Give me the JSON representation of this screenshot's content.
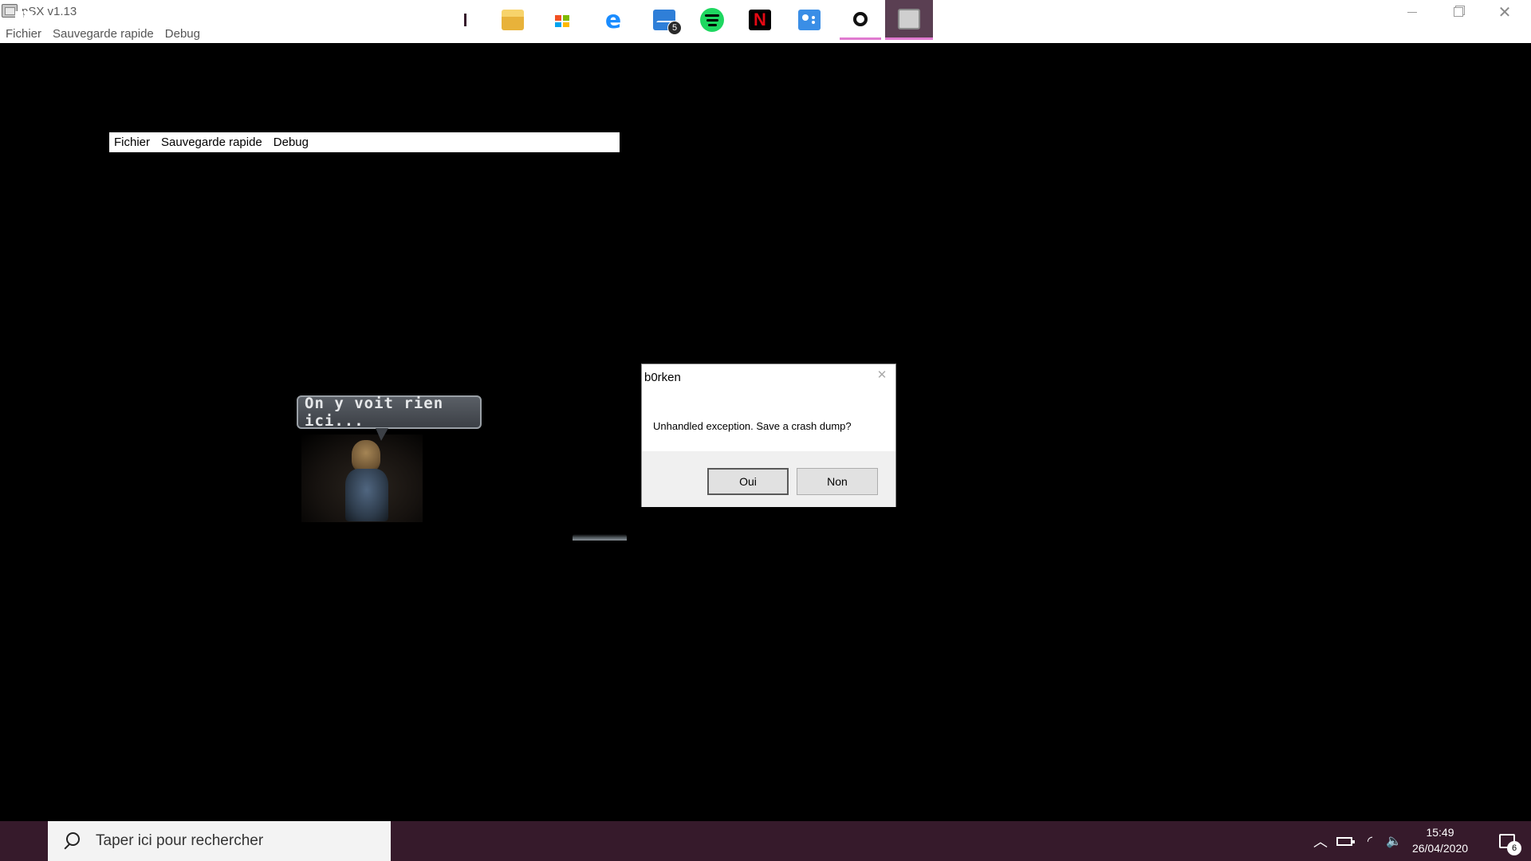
{
  "window": {
    "title": "pSX v1.13",
    "close_glyph": "✕"
  },
  "menubar": {
    "items": [
      "Fichier",
      "Sauvegarde rapide",
      "Debug"
    ]
  },
  "emulator": {
    "ghost_menu_items": [
      "Fichier",
      "Sauvegarde rapide",
      "Debug"
    ],
    "speech_bubble": "On y voit rien ici..."
  },
  "dialog": {
    "title": "b0rken",
    "message": "Unhandled exception.  Save a crash dump?",
    "yes_label": "Oui",
    "no_label": "Non",
    "close_glyph": "✕"
  },
  "taskbar": {
    "search_placeholder": "Taper ici pour rechercher",
    "mail_badge": "5",
    "netflix_glyph": "N",
    "edge_glyph": "e",
    "tray_chevron": "︿",
    "wifi_glyph": "◜",
    "volume_glyph": "🔈",
    "time": "15:49",
    "date": "26/04/2020",
    "notification_count": "6",
    "accent_color": "#361a2b",
    "active_indicator_color": "#e07ad0"
  }
}
